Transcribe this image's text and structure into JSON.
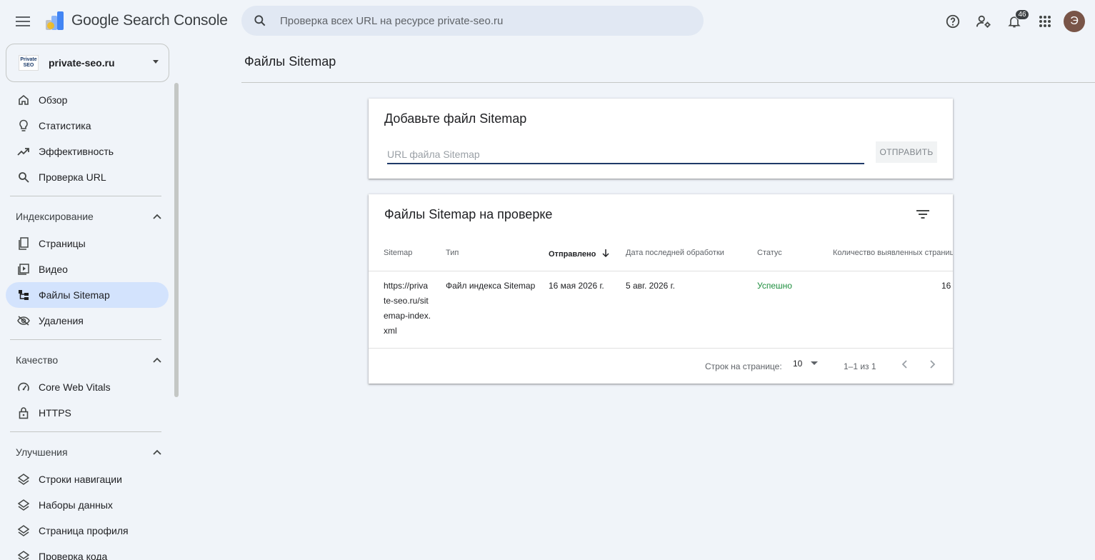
{
  "app": {
    "name": "Google Search Console"
  },
  "search": {
    "placeholder": "Проверка всех URL на ресурсе private-seo.ru"
  },
  "topbar": {
    "notifications_count": "46",
    "avatar_letter": "Э"
  },
  "property": {
    "logo_line1": "Private",
    "logo_line2": "SEO",
    "name": "private-seo.ru"
  },
  "nav": {
    "items_main": [
      {
        "label": "Обзор",
        "icon": "home-icon"
      },
      {
        "label": "Статистика",
        "icon": "lightbulb-icon"
      },
      {
        "label": "Эффективность",
        "icon": "trending-up-icon"
      },
      {
        "label": "Проверка URL",
        "icon": "search-icon"
      }
    ],
    "indexing": {
      "title": "Индексирование",
      "items": [
        {
          "label": "Страницы",
          "icon": "pages-icon"
        },
        {
          "label": "Видео",
          "icon": "video-icon"
        },
        {
          "label": "Файлы Sitemap",
          "icon": "sitemap-icon",
          "active": true
        },
        {
          "label": "Удаления",
          "icon": "removals-icon"
        }
      ]
    },
    "quality": {
      "title": "Качество",
      "items": [
        {
          "label": "Core Web Vitals",
          "icon": "speed-icon"
        },
        {
          "label": "HTTPS",
          "icon": "lock-icon"
        }
      ]
    },
    "enhancements": {
      "title": "Улучшения",
      "items": [
        {
          "label": "Строки навигации",
          "icon": "layers-icon"
        },
        {
          "label": "Наборы данных",
          "icon": "layers-icon"
        },
        {
          "label": "Страница профиля",
          "icon": "layers-icon"
        },
        {
          "label": "Проверка кода",
          "icon": "layers-icon"
        }
      ]
    }
  },
  "page": {
    "title": "Файлы Sitemap"
  },
  "add_sitemap": {
    "title": "Добавьте файл Sitemap",
    "input_placeholder": "URL файла Sitemap",
    "submit_label": "ОТПРАВИТЬ"
  },
  "submitted": {
    "title": "Файлы Sitemap на проверке",
    "columns": [
      "Sitemap",
      "Тип",
      "Отправлено",
      "Дата последней обработки",
      "Статус",
      "Количество выявленных страниц"
    ],
    "rows": [
      {
        "sitemap": "https://private-seo.ru/sitemap-index.xml",
        "sitemap_lines": [
          "https://priva",
          "te-seo.ru/sit",
          "emap-index.",
          "xml"
        ],
        "type": "Файл индекса Sitemap",
        "submitted": "16 мая 2026 г.",
        "last_read": "5 авг. 2026 г.",
        "status": "Успешно",
        "discovered": "16"
      }
    ],
    "footer": {
      "rows_label": "Строк на странице:",
      "rows_value": "10",
      "range": "1–1 из 1"
    }
  },
  "colors": {
    "background": "#f0f4f9",
    "active_nav": "#d3e3fd",
    "success": "#1e8e3e"
  }
}
